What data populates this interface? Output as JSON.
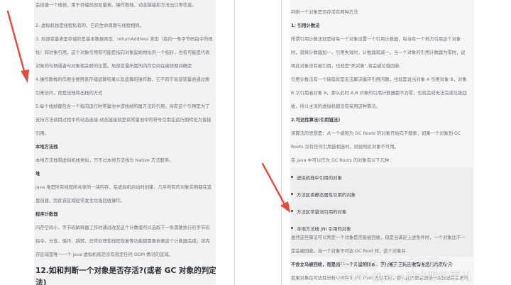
{
  "left": {
    "lines": [
      "会创建一个栈帧，用于存储局部变量表、操作数栈、动态链接和方法出口等信息。",
      "2. 虚拟机栈是线程私有的，它的生命周期与线程相同。",
      "3. 局部变量表里存储的是基本数据类型、returnAddress 类型（指向一条字节码指令的地",
      "址）和对象引用，这个对象引用有可能是指向对象起始地址的一个指针，也有可能是代表",
      "对象的句柄或者与对象相关联的位置。局部变量所需的内存空间在编译期间确定",
      "4.操作数栈的作用主要用来存储运算结果以及运算的操作数，它不同于局部变量表通过索",
      "引来访问，而是压栈和出栈的方式",
      "5.每个栈帧都包含一个指向运行时常量池中该栈帧所属方法的引用，持有这个引用是为了",
      "支持方法调用过程中的动态连接.动态链接就是将常量池中的符号引用在运行期转化为直接",
      "引用。",
      "本地方法栈",
      "本地方法栈和虚拟机栈类似，只不过本地方法栈为 Native 方法服务。",
      "堆",
      "java 堆是所有线程所共享的一块内存，在虚拟机启动时创建，几乎所有的对象实例都在这",
      "里创建，因此该区域经常发生垃圾回收操作。",
      "程序计数器",
      "内存空间小，字节码解释器工作时通过改变这个计数值可以选取下一条需要执行的字节码",
      "指令，分支、循环、跳转、异常处理和线程恢复等功能都需要依赖这个计数器完成。该内",
      "存区域是唯一一个 java 虚拟机规范没有规定任何 OOM 情况的区域。"
    ],
    "heading": "12.如和判断一个对象是否存活?(或者 GC 对象的判定方",
    "heading_cont": "法)"
  },
  "right": {
    "lines": [
      "判断一个对象是否存活有两种方法",
      "1. 引用计数法",
      "所谓引用计数法就是给每一个对象设置一个引用计数器，每当有一个地方引用这个对象",
      "时，就将计数器加一，引用失效时，计数器就减一。当一个对象的引用计数器为零时，说",
      "明此对象没有被引用，也就是\"死对象\",将会被垃圾回收.",
      "引用计数法有一个缺陷就是无法解决循环引用问题，也就是说当对象 A 引用对象 B，对象",
      "B 又引用者对象 A，那么此时 A,B 对象的引用计数器都不为零，也就造成无法完成垃圾回",
      "收，所以主流的虚拟机都没有采用这种算法。",
      "2.可达性算法(引用链法)",
      "该算法的思想是：从一个被称为 GC Roots 的对象开始向下搜索，如果一个对象到 GC",
      "Roots 没有任何引用链相连时，则说明此对象不可用。",
      "在 java 中可以作为 GC Roots 的对象有以下几种:"
    ],
    "bullets": [
      "虚拟机栈中引用的对象",
      "方法区类静态属性引用的对象",
      "方法区常量池引用的对象",
      "本地方法栈 JNI 引用的对象"
    ],
    "after": [
      "虽然这些算法可以判定一个对象是否能被回收，但是当满足上述条件时，一个对象比不一",
      "定会被回收。当一个对象不可达 GC Root 时，这个对象并",
      "不会立马被回收，而是出于一个死缓的阶段，若要被真正的回收需要经历两次标记",
      "如果对象在可达性分析中没有与 GC Root 的引用链，那么此时就会被第一次标记并且进行"
    ]
  },
  "watermarks": {
    "zhihu": "知乎 @冰美式不要冰",
    "csdn": "CSDN @Java技术那些事儿"
  },
  "colors": {
    "arrow": "#e24a3b",
    "page_bg": "#f2f2f2"
  }
}
